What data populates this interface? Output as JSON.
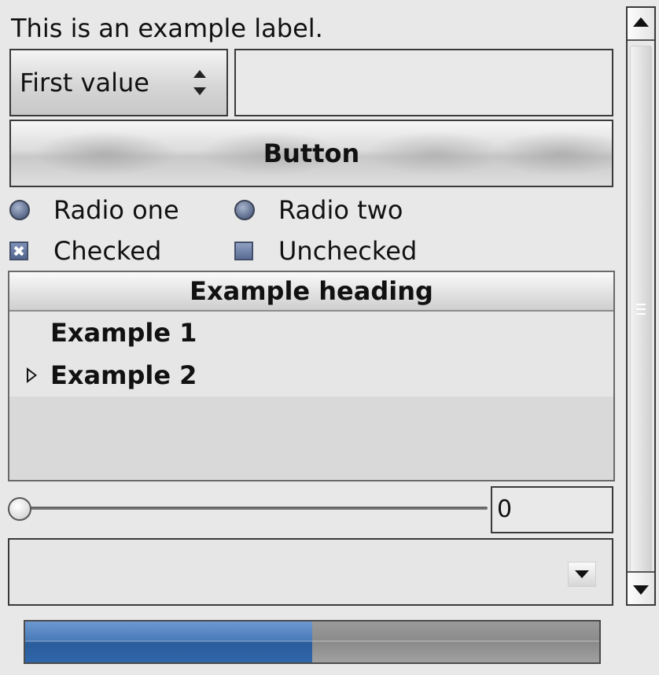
{
  "label": {
    "text": "This is an example label."
  },
  "spin_button": {
    "value": "First value"
  },
  "text_entry": {
    "value": ""
  },
  "button": {
    "label": "Button"
  },
  "radios": [
    {
      "label": "Radio one",
      "selected": false
    },
    {
      "label": "Radio two",
      "selected": false
    }
  ],
  "checkboxes": [
    {
      "label": "Checked",
      "checked": true
    },
    {
      "label": "Unchecked",
      "checked": false
    }
  ],
  "tree": {
    "heading": "Example heading",
    "rows": [
      {
        "label": "Example 1",
        "expandable": false
      },
      {
        "label": "Example 2",
        "expandable": true
      }
    ]
  },
  "slider": {
    "value": "0",
    "fraction": 0
  },
  "combo": {
    "value": ""
  },
  "progress": {
    "fraction": 0.5
  },
  "icons": {
    "spin": "up-down-arrows-icon",
    "combo": "chevron-down-icon",
    "scroll_up": "arrow-up-icon",
    "scroll_down": "arrow-down-icon",
    "expander": "triangle-right-icon",
    "check": "checkmark-icon"
  },
  "colors": {
    "accent": "#4a7cba",
    "background": "#e8e8e8"
  }
}
